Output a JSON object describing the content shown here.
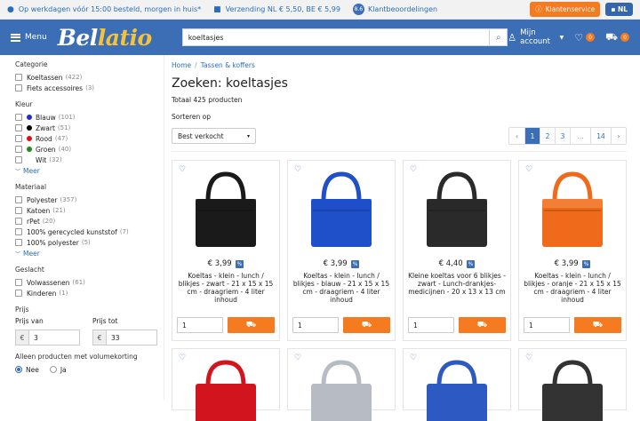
{
  "topbar": {
    "delivery": "Op werkdagen vóór 15:00 besteld, morgen in huis*",
    "shipping": "Verzending NL € 5,50, BE € 5,99",
    "rating": "8.6",
    "reviews": "Klantbeoordelingen",
    "service": "Klantenservice",
    "lang": "NL"
  },
  "header": {
    "menu": "Menu",
    "logo_a": "Bel",
    "logo_b": "latio",
    "search_value": "koeltasjes",
    "account": "Mijn account",
    "wishlist_count": "0",
    "cart_count": "0"
  },
  "sidebar": {
    "categorie": {
      "title": "Categorie",
      "items": [
        {
          "label": "Koeltassen",
          "count": "(422)"
        },
        {
          "label": "Fiets accessoires",
          "count": "(3)"
        }
      ]
    },
    "kleur": {
      "title": "Kleur",
      "items": [
        {
          "label": "Blauw",
          "count": "(101)",
          "color": "#1e2fd0"
        },
        {
          "label": "Zwart",
          "count": "(51)",
          "color": "#000000"
        },
        {
          "label": "Rood",
          "count": "(47)",
          "color": "#e01010"
        },
        {
          "label": "Groen",
          "count": "(40)",
          "color": "#1f8a1f"
        },
        {
          "label": "Wit",
          "count": "(32)",
          "color": "#ffffff"
        }
      ],
      "more": "Meer"
    },
    "materiaal": {
      "title": "Materiaal",
      "items": [
        {
          "label": "Polyester",
          "count": "(357)"
        },
        {
          "label": "Katoen",
          "count": "(21)"
        },
        {
          "label": "rPet",
          "count": "(20)"
        },
        {
          "label": "100% gerecycled kunststof",
          "count": "(7)"
        },
        {
          "label": "100% polyester",
          "count": "(5)"
        }
      ],
      "more": "Meer"
    },
    "geslacht": {
      "title": "Geslacht",
      "items": [
        {
          "label": "Volwassenen",
          "count": "(61)"
        },
        {
          "label": "Kinderen",
          "count": "(1)"
        }
      ]
    },
    "prijs": {
      "title": "Prijs",
      "from_label": "Prijs van",
      "to_label": "Prijs tot",
      "currency": "€",
      "from": "3",
      "to": "33"
    },
    "volume": {
      "title": "Alleen producten met volumekorting",
      "no": "Nee",
      "yes": "Ja"
    }
  },
  "main": {
    "crumb_home": "Home",
    "crumb_sep": "/",
    "crumb_cat": "Tassen & koffers",
    "heading": "Zoeken: koeltasjes",
    "total": "Totaal 425 producten",
    "sort_label": "Sorteren op",
    "sort_value": "Best verkocht",
    "pages": [
      "1",
      "2",
      "3",
      "...",
      "14"
    ],
    "prev": "‹",
    "next": "›"
  },
  "products": [
    {
      "price": "€ 3,99",
      "badge": "%",
      "title": "Koeltas - klein - lunch / blikjes - zwart - 21 x 15 x 15 cm - draagriem - 4 liter inhoud",
      "qty": "1",
      "color": "#1a1a1a"
    },
    {
      "price": "€ 3,99",
      "badge": "%",
      "title": "Koeltas - klein - lunch / blikjes - blauw - 21 x 15 x 15 cm - draagriem - 4 liter inhoud",
      "qty": "1",
      "color": "#1f4fc9"
    },
    {
      "price": "€ 4,40",
      "badge": "%",
      "title": "Kleine koeltas voor 6 blikjes - zwart - Lunch-drankjes-medicijnen - 20 x 13 x 13 cm",
      "qty": "1",
      "color": "#2a2a2a"
    },
    {
      "price": "€ 3,99",
      "badge": "%",
      "title": "Koeltas - klein - lunch / blikjes - oranje - 21 x 15 x 15 cm - draagriem - 4 liter inhoud",
      "qty": "1",
      "color": "#f06a1c"
    }
  ],
  "products_row2_colors": [
    "#d2141e",
    "#b7bcc4",
    "#2d5ac2",
    "#333333"
  ]
}
